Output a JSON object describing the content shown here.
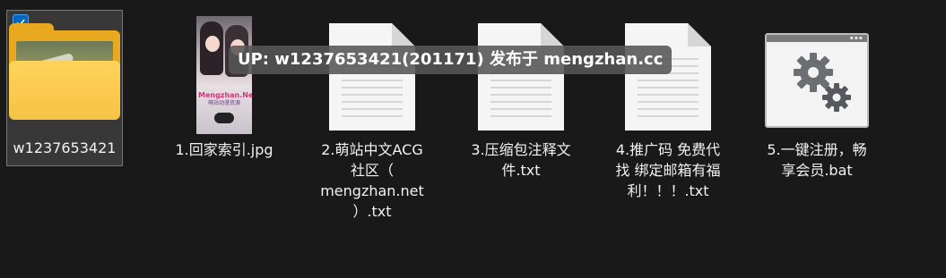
{
  "files": [
    {
      "label": "w1237653421",
      "type": "folder",
      "selected": true,
      "checked": true
    },
    {
      "label": "1.回家索引.jpg",
      "type": "image"
    },
    {
      "label": "2.萌站中文ACG\n社区（\nmengzhan.net\n）.txt",
      "type": "text"
    },
    {
      "label": "3.压缩包注释文\n件.txt",
      "type": "text"
    },
    {
      "label": "4.推广码 免费代\n找 绑定邮箱有福\n利！！！.txt",
      "type": "text"
    },
    {
      "label": "5.一键注册，畅\n享会员.bat",
      "type": "batch"
    }
  ],
  "thumbnail": {
    "brand": "Mengzhan.Net",
    "sub": "萌站动漫资源"
  },
  "tooltip": "UP: w1237653421(201171) 发布于 mengzhan.cc",
  "colors": {
    "background": "#191919",
    "selection": "#383838",
    "checkbox": "#0067c0",
    "folder": "#f6c344"
  },
  "icons": {
    "check": "checkmark-icon",
    "folder": "folder-icon",
    "document": "text-document-icon",
    "batch": "gear-settings-icon"
  }
}
